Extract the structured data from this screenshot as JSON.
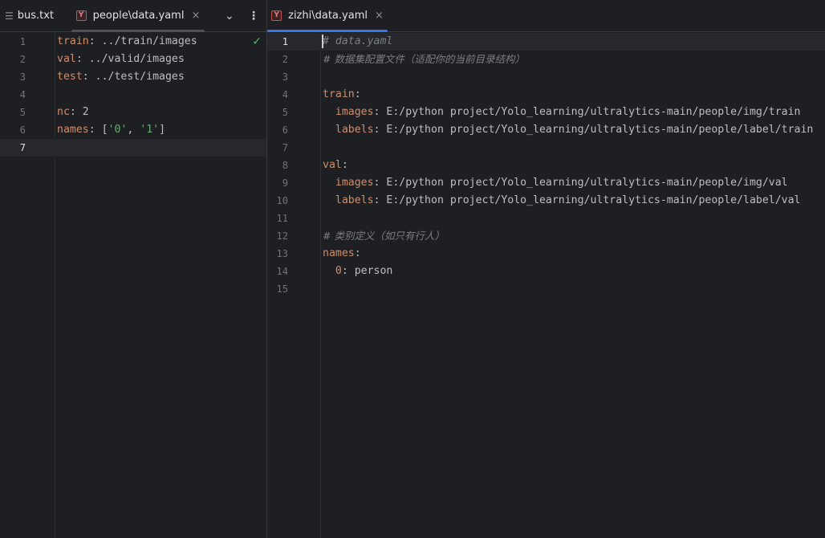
{
  "left_editor": {
    "tabs": [
      {
        "label": "bus.txt",
        "icon": "text-file-icon"
      },
      {
        "label": "people\\data.yaml",
        "icon": "yaml-file-icon",
        "close": "×"
      }
    ],
    "toolbar": {
      "chevron": "⌄",
      "more": "⋮"
    },
    "inspection": "✓",
    "lines": [
      {
        "n": "1",
        "key": "train",
        "sep": ": ",
        "value": "../train/images"
      },
      {
        "n": "2",
        "key": "val",
        "sep": ": ",
        "value": "../valid/images"
      },
      {
        "n": "3",
        "key": "test",
        "sep": ": ",
        "value": "../test/images"
      },
      {
        "n": "4"
      },
      {
        "n": "5",
        "key": "nc",
        "sep": ": ",
        "value": "2"
      },
      {
        "n": "6",
        "key": "names",
        "sep": ": ",
        "value_parts": [
          "[",
          "'0'",
          ", ",
          "'1'",
          "]"
        ]
      },
      {
        "n": "7"
      }
    ]
  },
  "right_editor": {
    "tabs": [
      {
        "label": "zizhi\\data.yaml",
        "icon": "yaml-file-icon",
        "close": "×"
      }
    ],
    "lines": [
      {
        "n": "1",
        "comment": "# data.yaml"
      },
      {
        "n": "2",
        "comment": "# 数据集配置文件（适配你的当前目录结构）"
      },
      {
        "n": "3"
      },
      {
        "n": "4",
        "key": "train",
        "sep": ":"
      },
      {
        "n": "5",
        "indent": "  ",
        "key": "images",
        "sep": ": ",
        "value": "E:/python project/Yolo_learning/ultralytics-main/people/img/train"
      },
      {
        "n": "6",
        "indent": "  ",
        "key": "labels",
        "sep": ": ",
        "value": "E:/python project/Yolo_learning/ultralytics-main/people/label/train"
      },
      {
        "n": "7"
      },
      {
        "n": "8",
        "key": "val",
        "sep": ":"
      },
      {
        "n": "9",
        "indent": "  ",
        "key": "images",
        "sep": ": ",
        "value": "E:/python project/Yolo_learning/ultralytics-main/people/img/val"
      },
      {
        "n": "10",
        "indent": "  ",
        "key": "labels",
        "sep": ": ",
        "value": "E:/python project/Yolo_learning/ultralytics-main/people/label/val"
      },
      {
        "n": "11"
      },
      {
        "n": "12",
        "comment": "# 类别定义（如只有行人）"
      },
      {
        "n": "13",
        "key": "names",
        "sep": ":"
      },
      {
        "n": "14",
        "indent": "  ",
        "key": "0",
        "sep": ": ",
        "value": "person"
      },
      {
        "n": "15"
      }
    ]
  },
  "colors": {
    "accent": "#3574f0",
    "key": "#cf8e6d",
    "string": "#6aab73",
    "comment": "#7a7e85",
    "text": "#bcbec4",
    "background": "#1e1f22"
  }
}
